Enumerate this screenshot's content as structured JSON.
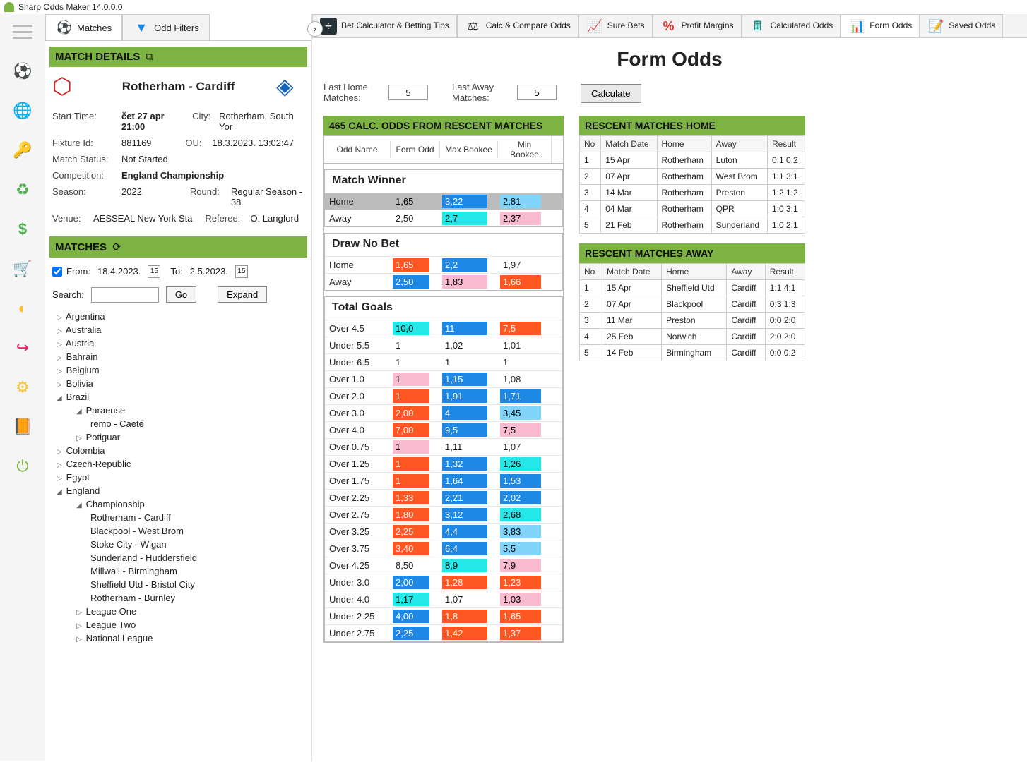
{
  "app": {
    "title": "Sharp Odds Maker 14.0.0.0"
  },
  "leftTabs": {
    "matches": "Matches",
    "filters": "Odd Filters"
  },
  "sections": {
    "matchDetails": "MATCH DETAILS",
    "matches": "MATCHES"
  },
  "match": {
    "title": "Rotherham - Cardiff",
    "startTimeLabel": "Start Time:",
    "startTime": "čet 27 apr 21:00",
    "cityLabel": "City:",
    "city": "Rotherham, South Yor",
    "fixtureIdLabel": "Fixture Id:",
    "fixtureId": "881169",
    "ouLabel": "OU:",
    "ou": "18.3.2023. 13:02:47",
    "statusLabel": "Match Status:",
    "status": "Not Started",
    "competitionLabel": "Competition:",
    "competition": "England Championship",
    "seasonLabel": "Season:",
    "season": "2022",
    "roundLabel": "Round:",
    "round": "Regular Season - 38",
    "venueLabel": "Venue:",
    "venue": "AESSEAL New York Sta",
    "refereeLabel": "Referee:",
    "referee": "O. Langford"
  },
  "dateFilter": {
    "fromLabel": "From:",
    "from": "18.4.2023.",
    "toLabel": "To:",
    "to": "2.5.2023."
  },
  "search": {
    "label": "Search:",
    "go": "Go",
    "expand": "Expand"
  },
  "countries": [
    {
      "name": "Argentina",
      "exp": false
    },
    {
      "name": "Australia",
      "exp": false
    },
    {
      "name": "Austria",
      "exp": false
    },
    {
      "name": "Bahrain",
      "exp": false
    },
    {
      "name": "Belgium",
      "exp": false
    },
    {
      "name": "Bolivia",
      "exp": false
    },
    {
      "name": "Brazil",
      "exp": true,
      "children": [
        {
          "name": "Paraense",
          "exp": true,
          "children": [
            {
              "name": "remo - Caeté"
            }
          ]
        },
        {
          "name": "Potiguar",
          "exp": false
        }
      ]
    },
    {
      "name": "Colombia",
      "exp": false
    },
    {
      "name": "Czech-Republic",
      "exp": false
    },
    {
      "name": "Egypt",
      "exp": false
    },
    {
      "name": "England",
      "exp": true,
      "children": [
        {
          "name": "Championship",
          "exp": true,
          "children": [
            {
              "name": "Rotherham - Cardiff"
            },
            {
              "name": "Blackpool - West Brom"
            },
            {
              "name": "Stoke City - Wigan"
            },
            {
              "name": "Sunderland - Huddersfield"
            },
            {
              "name": "Millwall - Birmingham"
            },
            {
              "name": "Sheffield Utd - Bristol City"
            },
            {
              "name": "Rotherham - Burnley"
            }
          ]
        },
        {
          "name": "League One",
          "exp": false
        },
        {
          "name": "League Two",
          "exp": false
        },
        {
          "name": "National League",
          "exp": false
        }
      ]
    }
  ],
  "topTabs": {
    "betCalc": "Bet Calculator & Betting Tips",
    "calcCompare": "Calc & Compare Odds",
    "sureBets": "Sure Bets",
    "profitMargins": "Profit Margins",
    "calculatedOdds": "Calculated Odds",
    "formOdds": "Form Odds",
    "savedOdds": "Saved Odds"
  },
  "form": {
    "title": "Form Odds",
    "lastHomeLabel": "Last Home Matches:",
    "lastHome": "5",
    "lastAwayLabel": "Last Away Matches:",
    "lastAway": "5",
    "calculate": "Calculate",
    "oddsHeader": "465 CALC. ODDS FROM RESCENT MATCHES",
    "homeHeader": "RESCENT MATCHES HOME",
    "awayHeader": "RESCENT MATCHES AWAY"
  },
  "oddsCols": {
    "name": "Odd Name",
    "form": "Form Odd",
    "max": "Max Bookee",
    "min": "Min Bookee"
  },
  "groups": [
    {
      "title": "Match Winner",
      "rows": [
        {
          "name": "Home",
          "v": [
            {
              "t": "1,65",
              "c": "gray"
            },
            {
              "t": "3,22",
              "c": "blue"
            },
            {
              "t": "2,81",
              "c": "lblue"
            }
          ],
          "sel": true
        },
        {
          "name": "Away",
          "v": [
            {
              "t": "2,50",
              "c": "white"
            },
            {
              "t": "2,7",
              "c": "cyan"
            },
            {
              "t": "2,37",
              "c": "pink"
            }
          ]
        }
      ]
    },
    {
      "title": "Draw No Bet",
      "rows": [
        {
          "name": "Home",
          "v": [
            {
              "t": "1,65",
              "c": "orange"
            },
            {
              "t": "2,2",
              "c": "blue"
            },
            {
              "t": "1,97",
              "c": "white"
            }
          ]
        },
        {
          "name": "Away",
          "v": [
            {
              "t": "2,50",
              "c": "blue"
            },
            {
              "t": "1,83",
              "c": "pink"
            },
            {
              "t": "1,66",
              "c": "orange"
            }
          ]
        }
      ]
    },
    {
      "title": "Total Goals",
      "rows": [
        {
          "name": "Over 4.5",
          "v": [
            {
              "t": "10,0",
              "c": "cyan"
            },
            {
              "t": "11",
              "c": "blue"
            },
            {
              "t": "7,5",
              "c": "orange"
            }
          ]
        },
        {
          "name": "Under 5.5",
          "v": [
            {
              "t": "1",
              "c": "white"
            },
            {
              "t": "1,02",
              "c": "white"
            },
            {
              "t": "1,01",
              "c": "white"
            }
          ]
        },
        {
          "name": "Under 6.5",
          "v": [
            {
              "t": "1",
              "c": "white"
            },
            {
              "t": "1",
              "c": "white"
            },
            {
              "t": "1",
              "c": "white"
            }
          ]
        },
        {
          "name": "Over 1.0",
          "v": [
            {
              "t": "1",
              "c": "pink"
            },
            {
              "t": "1,15",
              "c": "blue"
            },
            {
              "t": "1,08",
              "c": "white"
            }
          ]
        },
        {
          "name": "Over 2.0",
          "v": [
            {
              "t": "1",
              "c": "orange"
            },
            {
              "t": "1,91",
              "c": "blue"
            },
            {
              "t": "1,71",
              "c": "blue"
            }
          ]
        },
        {
          "name": "Over 3.0",
          "v": [
            {
              "t": "2,00",
              "c": "orange"
            },
            {
              "t": "4",
              "c": "blue"
            },
            {
              "t": "3,45",
              "c": "lblue"
            }
          ]
        },
        {
          "name": "Over 4.0",
          "v": [
            {
              "t": "7,00",
              "c": "orange"
            },
            {
              "t": "9,5",
              "c": "blue"
            },
            {
              "t": "7,5",
              "c": "pink"
            }
          ]
        },
        {
          "name": "Over 0.75",
          "v": [
            {
              "t": "1",
              "c": "pink"
            },
            {
              "t": "1,11",
              "c": "white"
            },
            {
              "t": "1,07",
              "c": "white"
            }
          ]
        },
        {
          "name": "Over 1.25",
          "v": [
            {
              "t": "1",
              "c": "orange"
            },
            {
              "t": "1,32",
              "c": "blue"
            },
            {
              "t": "1,26",
              "c": "cyan"
            }
          ]
        },
        {
          "name": "Over 1.75",
          "v": [
            {
              "t": "1",
              "c": "orange"
            },
            {
              "t": "1,64",
              "c": "blue"
            },
            {
              "t": "1,53",
              "c": "blue"
            }
          ]
        },
        {
          "name": "Over 2.25",
          "v": [
            {
              "t": "1,33",
              "c": "orange"
            },
            {
              "t": "2,21",
              "c": "blue"
            },
            {
              "t": "2,02",
              "c": "blue"
            }
          ]
        },
        {
          "name": "Over 2.75",
          "v": [
            {
              "t": "1,80",
              "c": "orange"
            },
            {
              "t": "3,12",
              "c": "blue"
            },
            {
              "t": "2,68",
              "c": "cyan"
            }
          ]
        },
        {
          "name": "Over 3.25",
          "v": [
            {
              "t": "2,25",
              "c": "orange"
            },
            {
              "t": "4,4",
              "c": "blue"
            },
            {
              "t": "3,83",
              "c": "lblue"
            }
          ]
        },
        {
          "name": "Over 3.75",
          "v": [
            {
              "t": "3,40",
              "c": "orange"
            },
            {
              "t": "6,4",
              "c": "blue"
            },
            {
              "t": "5,5",
              "c": "lblue"
            }
          ]
        },
        {
          "name": "Over 4.25",
          "v": [
            {
              "t": "8,50",
              "c": "white"
            },
            {
              "t": "8,9",
              "c": "cyan"
            },
            {
              "t": "7,9",
              "c": "pink"
            }
          ]
        },
        {
          "name": "Under 3.0",
          "v": [
            {
              "t": "2,00",
              "c": "blue"
            },
            {
              "t": "1,28",
              "c": "orange"
            },
            {
              "t": "1,23",
              "c": "orange"
            }
          ]
        },
        {
          "name": "Under 4.0",
          "v": [
            {
              "t": "1,17",
              "c": "cyan"
            },
            {
              "t": "1,07",
              "c": "white"
            },
            {
              "t": "1,03",
              "c": "pink"
            }
          ]
        },
        {
          "name": "Under 2.25",
          "v": [
            {
              "t": "4,00",
              "c": "blue"
            },
            {
              "t": "1,8",
              "c": "orange"
            },
            {
              "t": "1,65",
              "c": "orange"
            }
          ]
        },
        {
          "name": "Under 2.75",
          "v": [
            {
              "t": "2,25",
              "c": "blue"
            },
            {
              "t": "1,42",
              "c": "orange"
            },
            {
              "t": "1,37",
              "c": "orange"
            }
          ]
        }
      ]
    }
  ],
  "rmCols": {
    "no": "No",
    "date": "Match Date",
    "home": "Home",
    "away": "Away",
    "result": "Result"
  },
  "home": [
    {
      "no": "1",
      "date": "15 Apr",
      "home": "Rotherham",
      "away": "Luton",
      "res": "0:1 0:2"
    },
    {
      "no": "2",
      "date": "07 Apr",
      "home": "Rotherham",
      "away": "West Brom",
      "res": "1:1 3:1"
    },
    {
      "no": "3",
      "date": "14 Mar",
      "home": "Rotherham",
      "away": "Preston",
      "res": "1:2 1:2"
    },
    {
      "no": "4",
      "date": "04 Mar",
      "home": "Rotherham",
      "away": "QPR",
      "res": "1:0 3:1"
    },
    {
      "no": "5",
      "date": "21 Feb",
      "home": "Rotherham",
      "away": "Sunderland",
      "res": "1:0 2:1"
    }
  ],
  "away": [
    {
      "no": "1",
      "date": "15 Apr",
      "home": "Sheffield Utd",
      "away": "Cardiff",
      "res": "1:1 4:1"
    },
    {
      "no": "2",
      "date": "07 Apr",
      "home": "Blackpool",
      "away": "Cardiff",
      "res": "0:3 1:3"
    },
    {
      "no": "3",
      "date": "11 Mar",
      "home": "Preston",
      "away": "Cardiff",
      "res": "0:0 2:0"
    },
    {
      "no": "4",
      "date": "25 Feb",
      "home": "Norwich",
      "away": "Cardiff",
      "res": "2:0 2:0"
    },
    {
      "no": "5",
      "date": "14 Feb",
      "home": "Birmingham",
      "away": "Cardiff",
      "res": "0:0 0:2"
    }
  ]
}
